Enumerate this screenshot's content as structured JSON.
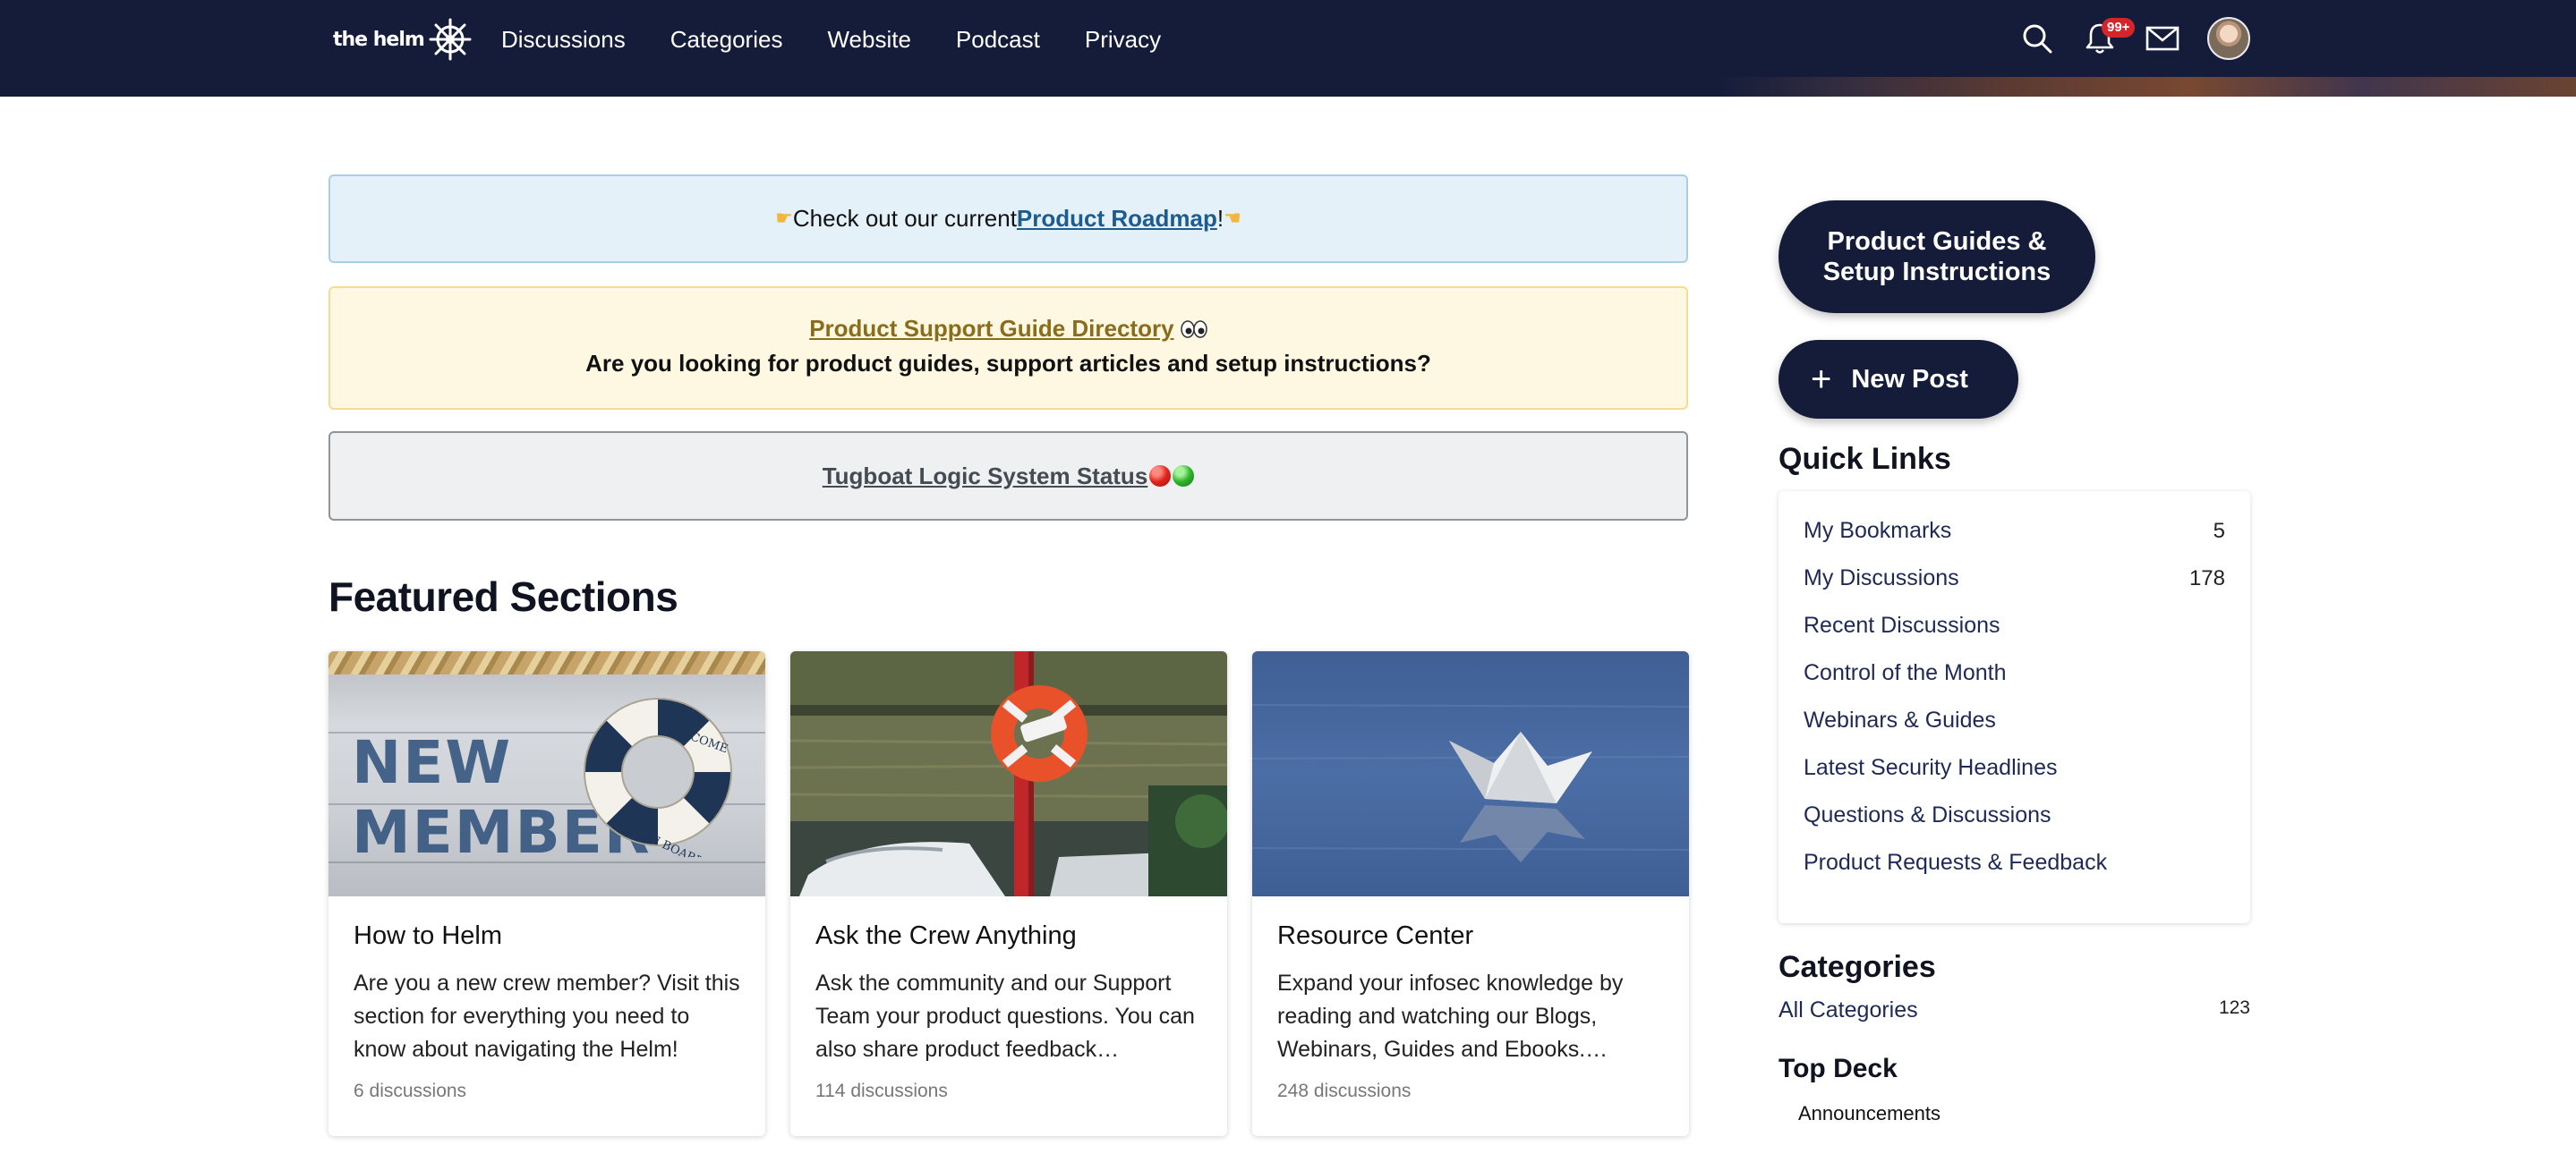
{
  "header": {
    "logo_text": "the helm",
    "nav": [
      "Discussions",
      "Categories",
      "Website",
      "Podcast",
      "Privacy"
    ],
    "notifications_badge": "99+",
    "icons": [
      "search-icon",
      "bell-icon",
      "mail-icon",
      "avatar"
    ]
  },
  "banners": {
    "roadmap": {
      "prefix": "Check out our current ",
      "link": "Product Roadmap",
      "suffix": "!"
    },
    "support": {
      "link": "Product Support Guide Directory",
      "subtitle": "Are you looking for product guides, support articles and setup instructions?"
    },
    "status": {
      "link": "Tugboat Logic System Status"
    }
  },
  "featured": {
    "title": "Featured Sections",
    "cards": [
      {
        "title": "How to Helm",
        "desc": "Are you a new crew member? Visit this section for everything you need to know about navigating the Helm!",
        "meta": "6 discussions",
        "image_text": [
          "NEW",
          "MEMBER"
        ],
        "lifebuoy_text": [
          "WELCOME",
          "ON BOARD"
        ]
      },
      {
        "title": "Ask the Crew Anything",
        "desc": "Ask the community and our Support Team your product questions. You can also share product feedback…",
        "meta": "114 discussions"
      },
      {
        "title": "Resource Center",
        "desc": "Expand your infosec knowledge by reading and watching our Blogs, Webinars, Guides and Ebooks.…",
        "meta": "248 discussions"
      }
    ]
  },
  "sidebar": {
    "guides_button": "Product Guides & Setup Instructions",
    "new_post_button": "New Post",
    "quick_links_title": "Quick Links",
    "quick_links": [
      {
        "label": "My Bookmarks",
        "count": "5"
      },
      {
        "label": "My Discussions",
        "count": "178"
      },
      {
        "label": "Recent Discussions",
        "count": ""
      },
      {
        "label": "Control of the Month",
        "count": ""
      },
      {
        "label": "Webinars & Guides",
        "count": ""
      },
      {
        "label": "Latest Security Headlines",
        "count": ""
      },
      {
        "label": "Questions & Discussions",
        "count": ""
      },
      {
        "label": "Product Requests & Feedback",
        "count": ""
      }
    ],
    "categories_title": "Categories",
    "all_categories": {
      "label": "All Categories",
      "count": "123"
    },
    "top_deck_title": "Top Deck",
    "top_deck_items": [
      "Announcements"
    ]
  },
  "colors": {
    "header_bg": "#141c3a",
    "accent_button": "#141c3a",
    "badge": "#d4252a",
    "link_blue": "#1d5c91",
    "link_gold": "#8a6d1c"
  }
}
